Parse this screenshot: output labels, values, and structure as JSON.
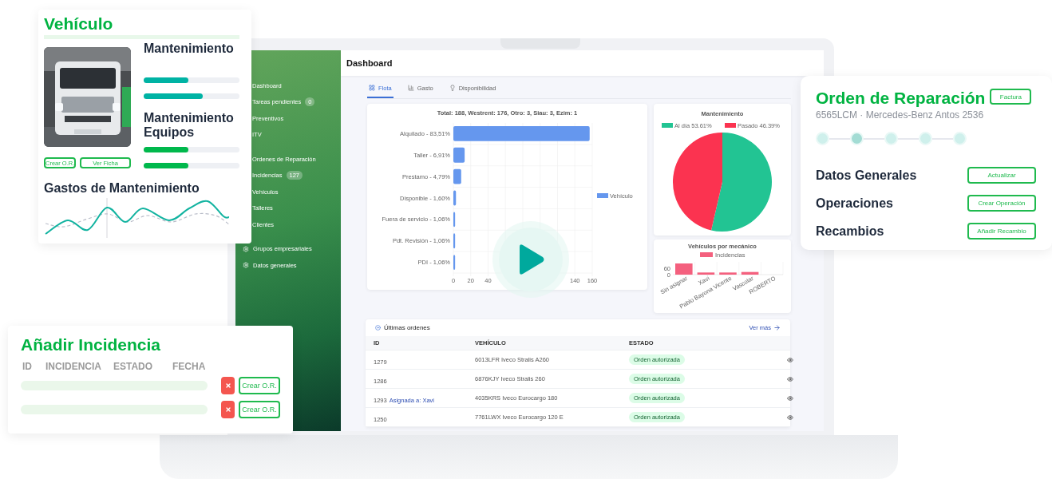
{
  "vehicle_card": {
    "title": "Vehículo",
    "photo": {
      "kind": "picture"
    },
    "sections": [
      {
        "title": "Mantenimiento",
        "color": "#00b3a4",
        "bars": [
          {
            "level": 0.47
          },
          {
            "level": 0.62
          }
        ]
      },
      {
        "title": "Mantenimiento Equipos",
        "color": "#00b84c",
        "bars": [
          {
            "level": 0.47
          },
          {
            "level": 0.47
          }
        ]
      }
    ],
    "buttons": [
      "Crear O.R.",
      "Ver Ficha"
    ],
    "expenses_title": "Gastos de Mantenimiento"
  },
  "sidebar": {
    "groups": [
      {
        "items": [
          {
            "label": "Dashboard",
            "kind": "link"
          },
          {
            "label": "Tareas pendientes",
            "badge": "0",
            "kind": "link"
          },
          {
            "label": "Preventivos",
            "kind": "link"
          },
          {
            "label": "ITV",
            "kind": "link"
          }
        ]
      },
      {
        "items": [
          {
            "label": "Ordenes de Reparación",
            "kind": "link"
          },
          {
            "label": "Incidencias",
            "badge": "127",
            "kind": "link"
          },
          {
            "label": "Vehículos",
            "kind": "link"
          },
          {
            "label": "Talleres",
            "kind": "link"
          },
          {
            "label": "Clientes",
            "kind": "link"
          }
        ]
      },
      {
        "items": [
          {
            "label": "Grupos empresariales",
            "kind": "settings"
          },
          {
            "label": "Datos generales",
            "kind": "settings"
          }
        ]
      }
    ]
  },
  "dashboard": {
    "title": "Dashboard",
    "tabs": [
      {
        "label": "Flota",
        "selected": true
      },
      {
        "label": "Gasto",
        "selected": false
      },
      {
        "label": "Disponibilidad",
        "selected": false
      }
    ],
    "fleet_chart": {
      "chart_data": {
        "type": "bar",
        "orientation": "horizontal",
        "title": "Total: 188, Westrent: 176, Otro: 3, Siau: 3, Ezim: 1",
        "categories": [
          "Alquilado - 83,51%",
          "Taller - 6,91%",
          "Prestamo - 4,79%",
          "Disponible - 1,60%",
          "Fuera de servicio - 1,06%",
          "Pdt. Revisión - 1,06%",
          "PDI - 1,06%"
        ],
        "series": [
          {
            "name": "Vehículo",
            "color": "#6597ee",
            "values": [
              157,
              13,
              9,
              3,
              2,
              2,
              2
            ]
          }
        ],
        "xlim": [
          0,
          160
        ],
        "xticks": [
          0,
          20,
          40,
          140,
          160
        ],
        "grid": true,
        "legend": true
      }
    },
    "maintenance_chart": {
      "chart_data": {
        "type": "pie",
        "title": "Mantenimiento",
        "categories": [
          "Al día 53.61%",
          "Pasado 46.39%"
        ],
        "series": [
          {
            "values": [
              53.61,
              46.39
            ]
          }
        ],
        "colors": [
          "#22c493",
          "#fb3350"
        ],
        "legend": true
      }
    },
    "mechanic_chart": {
      "chart_data": {
        "type": "bar",
        "title": "Vehículos por mecánico",
        "categories": [
          "Sin asignar",
          "Xavi",
          "Pablo Bayona Vicente",
          "Vascolar",
          "ROBERTO"
        ],
        "orientation": "vertical",
        "series": [
          {
            "name": "Incidencias",
            "color": "#f4607e",
            "values": [
              105,
              20,
              20,
              25,
              0
            ]
          }
        ],
        "ylim": [
          0,
          120
        ],
        "yticks": [
          0,
          60
        ],
        "grid": true,
        "legend": true
      }
    },
    "latest_orders": {
      "title": "Últimas ordenes",
      "link": "Ver más",
      "columns": [
        "ID",
        "VEHÍCULO",
        "ESTADO"
      ],
      "rows": [
        {
          "id": "1279",
          "vehicle": "6013LFR Iveco Stralis A260",
          "status": "Orden autorizada"
        },
        {
          "id": "1286",
          "vehicle": "6876KJY Iveco Stralis 260",
          "status": "Orden autorizada"
        },
        {
          "id": "1293",
          "assignee": "Asignada a: Xavi",
          "vehicle": "4035KRS Iveco Eurocargo 180",
          "status": "Orden autorizada"
        },
        {
          "id": "1250",
          "vehicle": "7761LWX Iveco Eurocargo 120 E",
          "status": "Orden autorizada"
        }
      ]
    }
  },
  "repair_order_card": {
    "title": "Orden de Reparación",
    "invoice_button": "Factura",
    "subtitle": "6565LCM · Mercedes-Benz Antos 2536",
    "steps": [
      {
        "selected": false
      },
      {
        "selected": true
      },
      {
        "selected": false
      },
      {
        "selected": false
      },
      {
        "selected": false
      }
    ],
    "sections": [
      {
        "title": "Datos Generales",
        "action": "Actualizar"
      },
      {
        "title": "Operaciones",
        "action": "Crear Operación"
      },
      {
        "title": "Recambios",
        "action": "Añadir Recambio"
      }
    ]
  },
  "incident_card": {
    "title": "Añadir Incidencia",
    "columns": [
      "ID",
      "INCIDENCIA",
      "ESTADO",
      "FECHA"
    ],
    "rows": [
      {
        "action": "Crear O.R."
      },
      {
        "action": "Crear O.R."
      }
    ]
  }
}
